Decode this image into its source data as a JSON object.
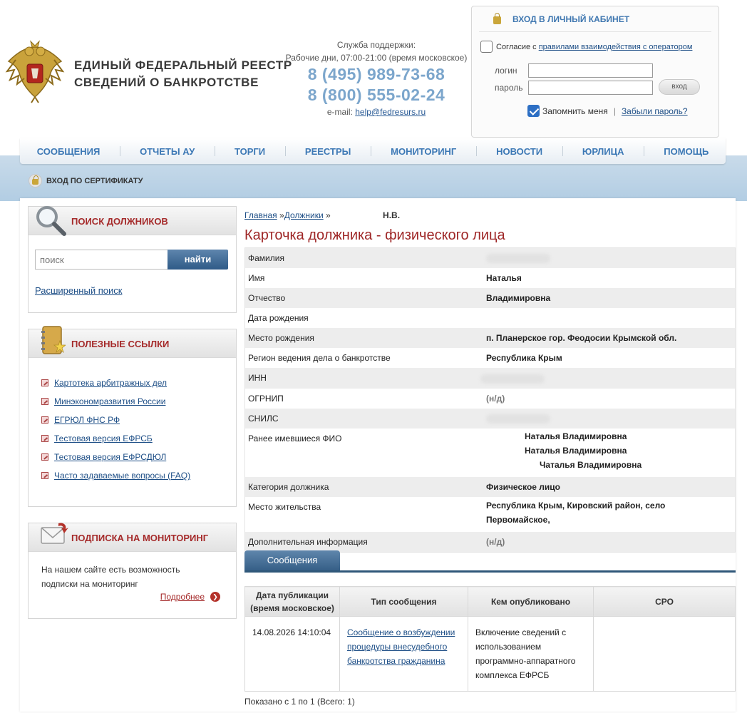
{
  "header": {
    "title_line1": "ЕДИНЫЙ  ФЕДЕРАЛЬНЫЙ  РЕЕСТР",
    "title_line2": "СВЕДЕНИЙ О БАНКРОТСТВЕ",
    "support_label": "Служба поддержки:",
    "support_hours": "Рабочие дни, 07:00-21:00 (время московское)",
    "phone1": "8 (495) 989-73-68",
    "phone2": "8 (800) 555-02-24",
    "email_label": "e-mail:",
    "email": "help@fedresurs.ru"
  },
  "login": {
    "heading": "ВХОД В ЛИЧНЫЙ КАБИНЕТ",
    "consent_text": "Согласие с",
    "consent_link": "правилами взаимодействия с оператором",
    "login_label": "логин",
    "password_label": "пароль",
    "submit_label": "вход",
    "remember_label": "Запомнить меня",
    "separator": "|",
    "forgot_link": "Забыли пароль?"
  },
  "nav": [
    "СООБЩЕНИЯ",
    "ОТЧЕТЫ АУ",
    "ТОРГИ",
    "РЕЕСТРЫ",
    "МОНИТОРИНГ",
    "НОВОСТИ",
    "ЮРЛИЦА",
    "ПОМОЩЬ"
  ],
  "cert_login": "ВХОД ПО СЕРТИФИКАТУ",
  "sidebar": {
    "search": {
      "title": "ПОИСК ДОЛЖНИКОВ",
      "placeholder": "поиск",
      "button": "найти",
      "advanced_link": "Расширенный поиск"
    },
    "links": {
      "title": "ПОЛЕЗНЫЕ ССЫЛКИ",
      "items": [
        "Картотека арбитражных дел",
        "Минэкономразвития России",
        "ЕГРЮЛ ФНС РФ",
        "Тестовая версия ЕФРСБ",
        "Тестовая версия ЕФРСДЮЛ",
        "Часто задаваемые вопросы (FAQ)"
      ]
    },
    "subscription": {
      "title": "ПОДПИСКА НА МОНИТОРИНГ",
      "text_line1": "На нашем сайте есть возможность",
      "text_line2": "подписки на мониторинг",
      "more_link": "Подробнее"
    }
  },
  "breadcrumb": {
    "home": "Главная",
    "sep1": " »",
    "debtors": "Должники",
    "sep2": " »",
    "current": "Н.В."
  },
  "page_title": "Карточка должника - физического лица",
  "details": {
    "surname_label": "Фамилия",
    "name_label": "Имя",
    "name_value": "Наталья",
    "patronymic_label": "Отчество",
    "patronymic_value": "Владимировна",
    "birthdate_label": "Дата рождения",
    "birthplace_label": "Место рождения",
    "birthplace_value": "п. Планерское гор. Феодосии Крымской обл.",
    "region_label": "Регион ведения дела о банкротстве",
    "region_value": "Республика Крым",
    "inn_label": "ИНН",
    "ogrnip_label": "ОГРНИП",
    "ogrnip_value": "(н/д)",
    "snils_label": "СНИЛС",
    "prev_names_label": "Ранее имевшиеся ФИО",
    "prev_name1": "Наталья Владимировна",
    "prev_name2": "Наталья Владимировна",
    "prev_name3": "Чаталья Владимировна",
    "category_label": "Категория должника",
    "category_value": "Физическое лицо",
    "residence_label": "Место жительства",
    "residence_line1": "Республика Крым, Кировский район, село",
    "residence_line2": "Первомайское,",
    "extra_label": "Дополнительная информация",
    "extra_value": "(н/д)"
  },
  "tabs": {
    "messages": "Сообщения"
  },
  "messages_table": {
    "col_date_line1": "Дата публикации",
    "col_date_line2": "(время московское)",
    "col_type": "Тип сообщения",
    "col_publisher": "Кем опубликовано",
    "col_sro": "СРО",
    "rows": [
      {
        "date": "14.08.2026 14:10:04",
        "type_line1": "Сообщение о возбуждении",
        "type_line2": "процедуры внесудебного",
        "type_line3": "банкротства гражданина",
        "pub_line1": "Включение сведений с",
        "pub_line2": "использованием",
        "pub_line3": "программно-аппаратного",
        "pub_line4": "комплекса ЕФРСБ",
        "sro": ""
      }
    ]
  },
  "pagination": "Показано с 1 по 1 (Всего: 1)",
  "colors": {
    "accent_red": "#9e2626",
    "nav_blue": "#3c78b5",
    "tab_blue": "#365f87"
  }
}
